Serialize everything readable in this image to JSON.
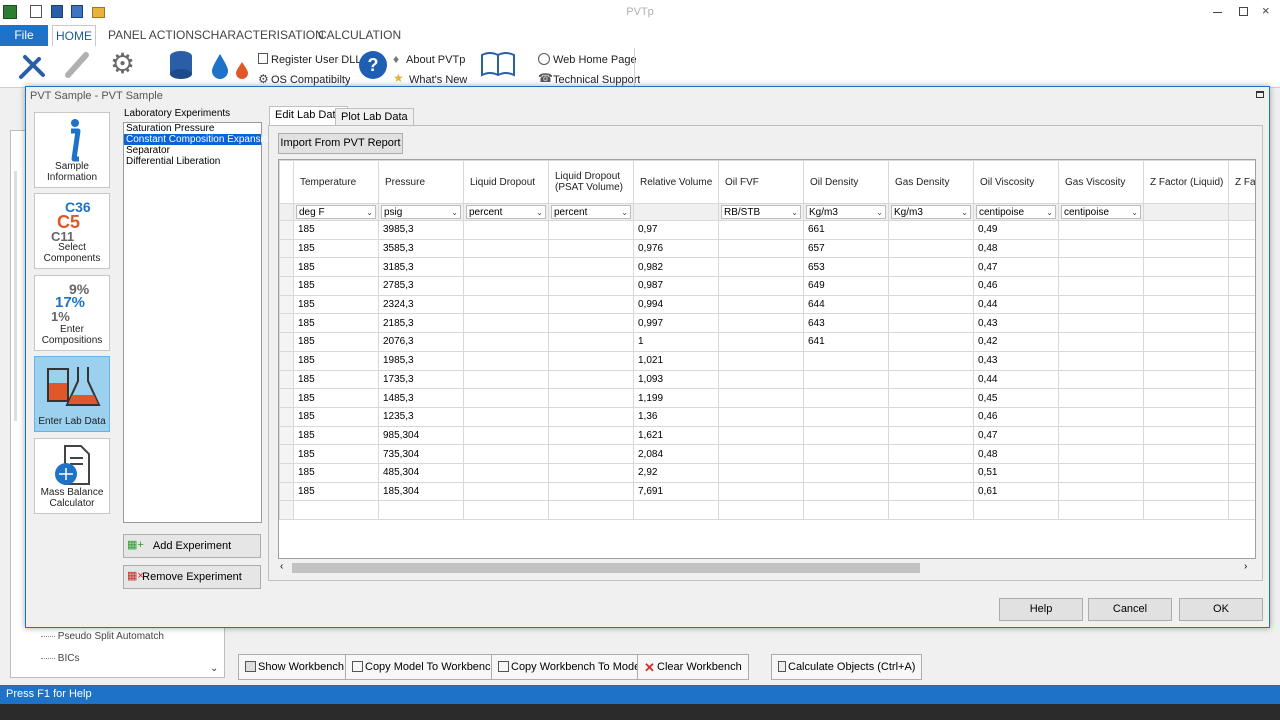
{
  "app": {
    "title": "PVTp"
  },
  "menu": {
    "file": "File",
    "tabs": [
      "HOME",
      "PANEL ACTIONS",
      "CHARACTERISATION",
      "CALCULATION"
    ]
  },
  "ribbon": {
    "register_dll": "Register User DLL",
    "os_compat": "OS Compatibilty",
    "about": "About PVTp",
    "whats_new": "What's New",
    "web_home": "Web Home Page",
    "tech_support": "Technical Support"
  },
  "left_panel": {
    "tree_items": [
      "Pseudo Split Automatch",
      "BICs"
    ]
  },
  "dialog": {
    "title": "PVT Sample - PVT Sample",
    "nav": [
      {
        "label": "Sample Information",
        "icon": "info-icon"
      },
      {
        "label": "Select Components",
        "icon": "components-icon"
      },
      {
        "label": "Enter Compositions",
        "icon": "compositions-icon"
      },
      {
        "label": "Enter Lab Data",
        "icon": "flask-icon"
      },
      {
        "label": "Mass Balance Calculator",
        "icon": "mass-balance-icon"
      }
    ],
    "nav_glyphs": {
      "c36": "C36",
      "c5": "C5",
      "c11": "C11",
      "p9": "9%",
      "p17": "17%",
      "p1": "1%"
    },
    "experiments_label": "Laboratory Experiments",
    "experiments": [
      "Saturation Pressure",
      "Constant Composition Expansion",
      "Separator",
      "Differential Liberation"
    ],
    "add_experiment": "Add Experiment",
    "remove_experiment": "Remove Experiment",
    "tabs": [
      "Edit Lab Data",
      "Plot Lab Data"
    ],
    "import_button": "Import From PVT Report",
    "buttons": {
      "help": "Help",
      "cancel": "Cancel",
      "ok": "OK"
    }
  },
  "grid": {
    "columns": [
      "Temperature",
      "Pressure",
      "Liquid Dropout",
      "Liquid Dropout\n(PSAT Volume)",
      "Relative Volume",
      "Oil FVF",
      "Oil Density",
      "Gas Density",
      "Oil Viscosity",
      "Gas Viscosity",
      "Z Factor (Liquid)",
      "Z Fa"
    ],
    "units": [
      "deg F",
      "psig",
      "percent",
      "percent",
      "",
      "RB/STB",
      "Kg/m3",
      "Kg/m3",
      "centipoise",
      "centipoise",
      "",
      ""
    ],
    "unit_has_dropdown": [
      true,
      true,
      true,
      true,
      false,
      true,
      true,
      true,
      true,
      true,
      false,
      false
    ],
    "rows": [
      [
        "185",
        "3985,3",
        "",
        "",
        "0,97",
        "",
        "661",
        "",
        "0,49",
        "",
        "",
        ""
      ],
      [
        "185",
        "3585,3",
        "",
        "",
        "0,976",
        "",
        "657",
        "",
        "0,48",
        "",
        "",
        ""
      ],
      [
        "185",
        "3185,3",
        "",
        "",
        "0,982",
        "",
        "653",
        "",
        "0,47",
        "",
        "",
        ""
      ],
      [
        "185",
        "2785,3",
        "",
        "",
        "0,987",
        "",
        "649",
        "",
        "0,46",
        "",
        "",
        ""
      ],
      [
        "185",
        "2324,3",
        "",
        "",
        "0,994",
        "",
        "644",
        "",
        "0,44",
        "",
        "",
        ""
      ],
      [
        "185",
        "2185,3",
        "",
        "",
        "0,997",
        "",
        "643",
        "",
        "0,43",
        "",
        "",
        ""
      ],
      [
        "185",
        "2076,3",
        "",
        "",
        "1",
        "",
        "641",
        "",
        "0,42",
        "",
        "",
        ""
      ],
      [
        "185",
        "1985,3",
        "",
        "",
        "1,021",
        "",
        "",
        "",
        "0,43",
        "",
        "",
        ""
      ],
      [
        "185",
        "1735,3",
        "",
        "",
        "1,093",
        "",
        "",
        "",
        "0,44",
        "",
        "",
        ""
      ],
      [
        "185",
        "1485,3",
        "",
        "",
        "1,199",
        "",
        "",
        "",
        "0,45",
        "",
        "",
        ""
      ],
      [
        "185",
        "1235,3",
        "",
        "",
        "1,36",
        "",
        "",
        "",
        "0,46",
        "",
        "",
        ""
      ],
      [
        "185",
        "985,304",
        "",
        "",
        "1,621",
        "",
        "",
        "",
        "0,47",
        "",
        "",
        ""
      ],
      [
        "185",
        "735,304",
        "",
        "",
        "2,084",
        "",
        "",
        "",
        "0,48",
        "",
        "",
        ""
      ],
      [
        "185",
        "485,304",
        "",
        "",
        "2,92",
        "",
        "",
        "",
        "0,51",
        "",
        "",
        ""
      ],
      [
        "185",
        "185,304",
        "",
        "",
        "7,691",
        "",
        "",
        "",
        "0,61",
        "",
        "",
        ""
      ],
      [
        "",
        "",
        "",
        "",
        "",
        "",
        "",
        "",
        "",
        "",
        "",
        ""
      ]
    ]
  },
  "workbench": {
    "show": "Show Workbench",
    "copy_model": "Copy Model To Workbench",
    "copy_workbench": "Copy Workbench To Model",
    "clear": "Clear Workbench",
    "calculate": "Calculate Objects (Ctrl+A)"
  },
  "status": {
    "text": "Press F1 for Help"
  },
  "colors": {
    "accent": "#1e73c8",
    "selection": "#0a64d8",
    "nav_selected": "#9bd0ee",
    "c5_orange": "#e0572a",
    "c36_blue": "#1e73c8"
  }
}
